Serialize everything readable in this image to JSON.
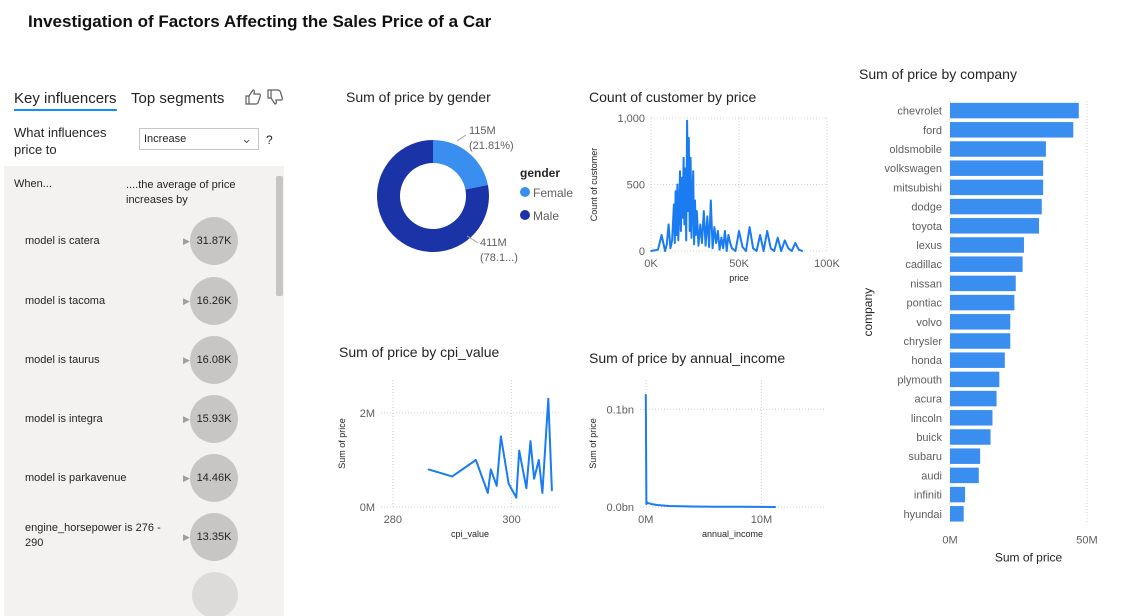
{
  "report_title": "Investigation of Factors Affecting the Sales Price of a Car",
  "key_influencers": {
    "tabs": [
      "Key influencers",
      "Top segments"
    ],
    "question": "What influences price to",
    "dropdown_value": "Increase",
    "help": "?",
    "col_when": "When...",
    "col_avg": "....the average of price increases by",
    "rows": [
      {
        "label": "model is catera",
        "value": "31.87K"
      },
      {
        "label": "model is tacoma",
        "value": "16.26K"
      },
      {
        "label": "model is taurus",
        "value": "16.08K"
      },
      {
        "label": "model is integra",
        "value": "15.93K"
      },
      {
        "label": "model is parkavenue",
        "value": "14.46K"
      },
      {
        "label": "engine_horsepower is 276 - 290",
        "value": "13.35K"
      }
    ]
  },
  "chart_data": [
    {
      "type": "pie",
      "variant": "donut",
      "title": "Sum of price by gender",
      "legend_title": "gender",
      "legend_position": "right",
      "slices": [
        {
          "name": "Female",
          "value": 115,
          "label": "115M",
          "pct_label": "(21.81%)",
          "color": "#3a8ef0"
        },
        {
          "name": "Male",
          "value": 411,
          "label": "411M",
          "pct_label": "(78.1...)",
          "color": "#1a33a6"
        }
      ]
    },
    {
      "type": "line",
      "title": "Count of customer by price",
      "xlabel": "price",
      "ylabel": "Count of customer",
      "xlim": [
        0,
        100000
      ],
      "ylim": [
        0,
        1000
      ],
      "xticks": [
        "0K",
        "50K",
        "100K"
      ],
      "yticks": [
        "0",
        "500",
        "1,000"
      ],
      "grid": true,
      "color": "#1a7cf0",
      "x": [
        0,
        4000,
        6000,
        8000,
        9000,
        10000,
        11000,
        12000,
        13000,
        13500,
        14000,
        14500,
        15000,
        15500,
        16000,
        16500,
        17000,
        17500,
        18000,
        18500,
        19000,
        19500,
        20000,
        20500,
        21000,
        21500,
        22000,
        22500,
        23000,
        23500,
        24000,
        24500,
        25000,
        25500,
        26000,
        27000,
        28000,
        29000,
        30000,
        31000,
        32000,
        33000,
        34000,
        35000,
        36000,
        37000,
        38000,
        39000,
        40000,
        41000,
        42000,
        43000,
        44000,
        45000,
        46000,
        48000,
        50000,
        52000,
        54000,
        56000,
        58000,
        60000,
        62000,
        64000,
        66000,
        68000,
        70000,
        72000,
        74000,
        76000,
        78000,
        80000,
        82000,
        84000,
        86000
      ],
      "y": [
        0,
        10,
        120,
        0,
        50,
        200,
        20,
        80,
        350,
        60,
        450,
        120,
        500,
        80,
        300,
        600,
        150,
        550,
        250,
        700,
        200,
        620,
        80,
        980,
        300,
        850,
        150,
        700,
        100,
        400,
        600,
        50,
        380,
        120,
        300,
        40,
        200,
        60,
        300,
        40,
        260,
        30,
        380,
        20,
        180,
        60,
        150,
        10,
        100,
        20,
        150,
        0,
        120,
        60,
        20,
        0,
        150,
        30,
        0,
        180,
        20,
        0,
        120,
        0,
        150,
        20,
        0,
        100,
        0,
        80,
        20,
        0,
        60,
        10,
        0
      ]
    },
    {
      "type": "line",
      "title": "Sum of price by cpi_value",
      "xlabel": "cpi_value",
      "ylabel": "Sum of price",
      "xlim": [
        278,
        308
      ],
      "ylim": [
        0,
        2700000
      ],
      "xticks": [
        "280",
        "300"
      ],
      "yticks": [
        "0M",
        "2M"
      ],
      "grid": true,
      "color": "#1a7cf0",
      "x": [
        286,
        290,
        294,
        296,
        296.5,
        297.5,
        298.2,
        299.5,
        300.8,
        301.3,
        302.5,
        303.2,
        303.8,
        304.6,
        305.2,
        305.8,
        306.2,
        306.8
      ],
      "y": [
        800000,
        650000,
        1000000,
        300000,
        800000,
        450000,
        1500000,
        500000,
        200000,
        1200000,
        400000,
        1400000,
        600000,
        1000000,
        300000,
        1500000,
        2300000,
        350000
      ]
    },
    {
      "type": "line",
      "title": "Sum of price by annual_income",
      "xlabel": "annual_income",
      "ylabel": "Sum of price",
      "xlim": [
        -500000,
        15500000
      ],
      "ylim": [
        0,
        130000000
      ],
      "xticks": [
        "0M",
        "10M"
      ],
      "yticks": [
        "0.0bn",
        "0.1bn"
      ],
      "grid": true,
      "color": "#1a7cf0",
      "x": [
        0,
        50000,
        100000,
        200000,
        500000,
        1000000,
        2000000,
        4000000,
        6000000,
        8000000,
        10000000,
        11200000
      ],
      "y": [
        115000000,
        3000000,
        5000000,
        4000000,
        3000000,
        2000000,
        1000000,
        500000,
        300000,
        200000,
        100000,
        0
      ]
    },
    {
      "type": "bar",
      "orientation": "horizontal",
      "title": "Sum of price by company",
      "xlabel": "Sum of price",
      "ylabel": "company",
      "xlim": [
        0,
        50
      ],
      "xticks": [
        "0M",
        "50M"
      ],
      "grid": true,
      "color": "#3a8ef0",
      "categories": [
        "chevrolet",
        "ford",
        "oldsmobile",
        "volkswagen",
        "mitsubishi",
        "dodge",
        "toyota",
        "lexus",
        "cadillac",
        "nissan",
        "pontiac",
        "volvo",
        "chrysler",
        "honda",
        "plymouth",
        "acura",
        "lincoln",
        "buick",
        "subaru",
        "audi",
        "infiniti",
        "hyundai"
      ],
      "values": [
        47,
        45,
        35,
        34,
        34,
        33.5,
        32.5,
        27,
        26.5,
        24,
        23.5,
        22,
        22,
        20,
        18,
        17,
        15.5,
        14.8,
        11,
        10.5,
        5.5,
        5
      ]
    }
  ]
}
